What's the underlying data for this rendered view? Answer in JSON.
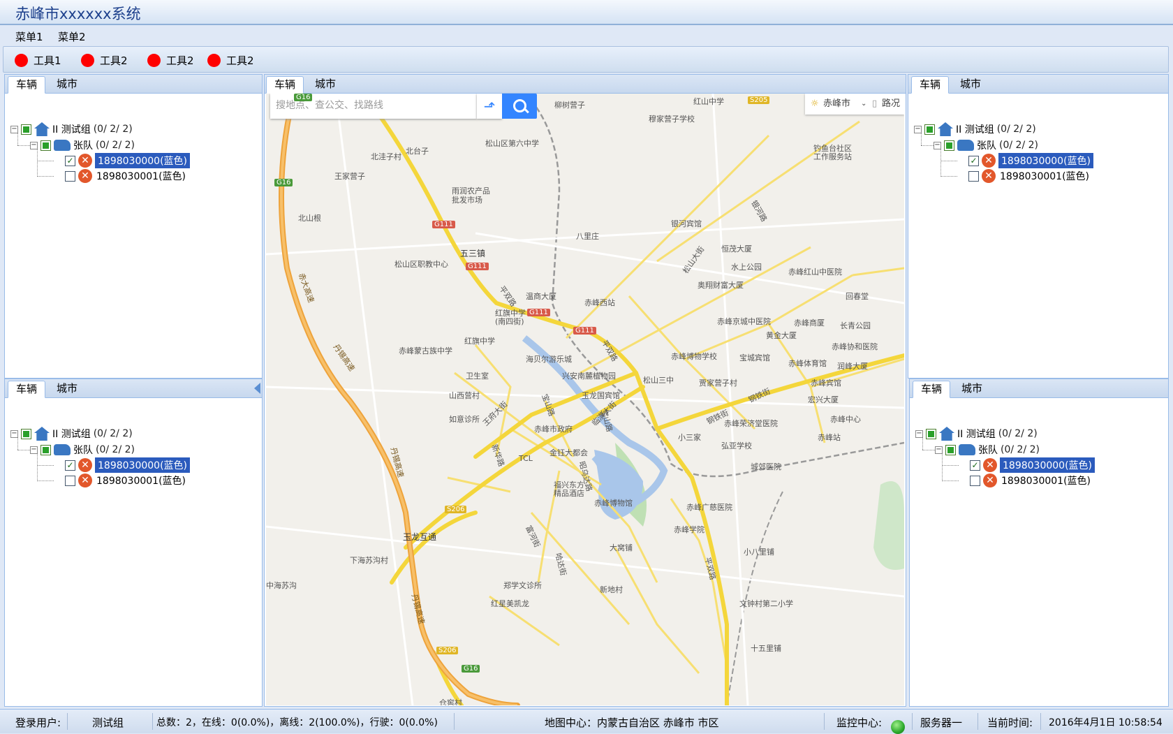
{
  "app": {
    "title": "赤峰市xxxxxx系统"
  },
  "menu": {
    "items": [
      "菜单1",
      "菜单2"
    ]
  },
  "toolbar": {
    "tools": [
      "工具1",
      "工具2",
      "工具2",
      "工具2"
    ],
    "tool_color": "#ff0000"
  },
  "tree_panel": {
    "tabs": [
      "车辆",
      "城市"
    ],
    "group": "II 测试组",
    "group_count": "(0/ 2/ 2)",
    "team": "张队",
    "team_count": "(0/ 2/ 2)",
    "vehicles": [
      {
        "label": "1898030000(蓝色)",
        "checked": true,
        "selected": true
      },
      {
        "label": "1898030001(蓝色)",
        "checked": false,
        "selected": false
      }
    ]
  },
  "map_panel": {
    "tabs": [
      "车辆",
      "城市"
    ],
    "search_placeholder": "搜地点、查公交、找路线",
    "city": "赤峰市",
    "traffic": "路况",
    "labels": {
      "l1": "柳树营子",
      "l2": "红山中学",
      "l3": "穆家营子学校",
      "l4": "北洼子村",
      "l5": "北台子",
      "l6": "松山区第六中学",
      "l7": "钓鱼台社区",
      "l7b": "工作服务站",
      "l8": "王家营子",
      "l9": "雨润农产品",
      "l9b": "批发市场",
      "l10": "北山根",
      "l11": "银河宾馆",
      "l12": "八里庄",
      "l13": "五三镇",
      "l14": "恒茂大厦",
      "l15": "松山区职教中心",
      "l16": "水上公园",
      "l17": "赤峰红山中医院",
      "l18": "奥翔财富大厦",
      "l19": "温商大厦",
      "l20": "赤峰西站",
      "l21": "回春堂",
      "l22": "红旗中学",
      "l22b": "(南四街)",
      "l23": "赤峰京城中医院",
      "l24": "赤峰商厦",
      "l25": "长青公园",
      "l26": "红旗中学",
      "l27": "黄金大厦",
      "l28": "赤峰协和医院",
      "l29": "赤峰蒙古族中学",
      "l30": "海贝尔游乐城",
      "l31": "赤峰博物学校",
      "l32": "宝城宾馆",
      "l33": "赤峰体育馆",
      "l34": "润峰大厦",
      "l35": "卫生室",
      "l36": "兴安南麓植物园",
      "l37": "松山三中",
      "l38": "贾家营子村",
      "l39": "山西营村",
      "l40": "玉龙国宾馆",
      "l41": "赤峰宾馆",
      "l42": "宏兴大厦",
      "l43": "如意诊所",
      "l44": "赤峰市政府",
      "l45": "赤峰荣济堂医院",
      "l46": "赤峰中心",
      "l47": "小三家",
      "l48": "赤峰站",
      "l49": "弘亚学校",
      "l50": "TCL",
      "l51": "金钰大都会",
      "l52": "城郊医院",
      "l53": "福兴东方",
      "l53b": "精品酒店",
      "l54": "赤峰博物馆",
      "l55": "赤峰广慈医院",
      "l56": "赤峰学院",
      "l57": "玉龙互通",
      "l58": "大窝铺",
      "l59": "小八里铺",
      "l60": "下海苏沟村",
      "l61": "郑学文诊所",
      "l62": "新地村",
      "l63": "中海苏沟",
      "l64": "红星美凯龙",
      "l65": "文钟村第二小学",
      "l66": "十五里铺",
      "l67": "仓窖村",
      "r1": "赤大高速",
      "r2": "丹锡高速",
      "r3": "丹锡高速",
      "r4": "丹锡高速",
      "r5": "平双路",
      "r6": "平双路",
      "r7": "松山大街",
      "r8": "银河路",
      "r9": "王府大街",
      "r10": "宝山路",
      "r11": "临潢大街",
      "r12": "新华路",
      "r13": "钢铁街",
      "r14": "钢铁街",
      "r15": "平双路",
      "r16": "昭乌达路",
      "r17": "富河街",
      "r18": "哈达街",
      "r19": "宝山路",
      "s1": "G16",
      "s2": "G111",
      "s3": "G111",
      "s4": "G111",
      "s5": "G111",
      "s6": "S205",
      "s7": "S206",
      "s8": "S206",
      "s9": "G16",
      "s10": "G16"
    }
  },
  "status": {
    "login_label": "登录用户:",
    "login_user": "测试组",
    "stats": "总数：2，在线：0(0.0%)，离线：2(100.0%)，行驶：0(0.0%)",
    "map_center": "地图中心：内蒙古自治区 赤峰市 市区",
    "monitor_label": "监控中心:",
    "server": "服务器一",
    "time_label": "当前时间:",
    "time_value": "2016年4月1日 10:58:54",
    "online_color": "#2aa82a"
  }
}
